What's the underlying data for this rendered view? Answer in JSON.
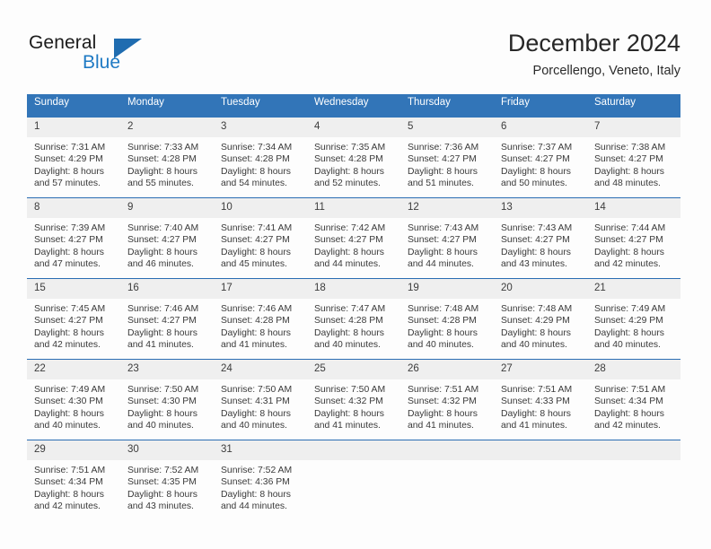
{
  "brand": {
    "name_top": "General",
    "name_bottom": "Blue",
    "triangle_color": "#1f6cb0",
    "blue_color": "#1f7ac4"
  },
  "header": {
    "title": "December 2024",
    "subtitle": "Porcellengo, Veneto, Italy"
  },
  "theme": {
    "header_bg": "#3275b8",
    "header_text": "#ffffff",
    "row_divider": "#2a6db3",
    "daynum_bg": "#efefef",
    "page_bg": "#fdfdfd"
  },
  "weekdays": [
    "Sunday",
    "Monday",
    "Tuesday",
    "Wednesday",
    "Thursday",
    "Friday",
    "Saturday"
  ],
  "weeks": [
    [
      {
        "day": "1",
        "sunrise": "Sunrise: 7:31 AM",
        "sunset": "Sunset: 4:29 PM",
        "daylight1": "Daylight: 8 hours",
        "daylight2": "and 57 minutes."
      },
      {
        "day": "2",
        "sunrise": "Sunrise: 7:33 AM",
        "sunset": "Sunset: 4:28 PM",
        "daylight1": "Daylight: 8 hours",
        "daylight2": "and 55 minutes."
      },
      {
        "day": "3",
        "sunrise": "Sunrise: 7:34 AM",
        "sunset": "Sunset: 4:28 PM",
        "daylight1": "Daylight: 8 hours",
        "daylight2": "and 54 minutes."
      },
      {
        "day": "4",
        "sunrise": "Sunrise: 7:35 AM",
        "sunset": "Sunset: 4:28 PM",
        "daylight1": "Daylight: 8 hours",
        "daylight2": "and 52 minutes."
      },
      {
        "day": "5",
        "sunrise": "Sunrise: 7:36 AM",
        "sunset": "Sunset: 4:27 PM",
        "daylight1": "Daylight: 8 hours",
        "daylight2": "and 51 minutes."
      },
      {
        "day": "6",
        "sunrise": "Sunrise: 7:37 AM",
        "sunset": "Sunset: 4:27 PM",
        "daylight1": "Daylight: 8 hours",
        "daylight2": "and 50 minutes."
      },
      {
        "day": "7",
        "sunrise": "Sunrise: 7:38 AM",
        "sunset": "Sunset: 4:27 PM",
        "daylight1": "Daylight: 8 hours",
        "daylight2": "and 48 minutes."
      }
    ],
    [
      {
        "day": "8",
        "sunrise": "Sunrise: 7:39 AM",
        "sunset": "Sunset: 4:27 PM",
        "daylight1": "Daylight: 8 hours",
        "daylight2": "and 47 minutes."
      },
      {
        "day": "9",
        "sunrise": "Sunrise: 7:40 AM",
        "sunset": "Sunset: 4:27 PM",
        "daylight1": "Daylight: 8 hours",
        "daylight2": "and 46 minutes."
      },
      {
        "day": "10",
        "sunrise": "Sunrise: 7:41 AM",
        "sunset": "Sunset: 4:27 PM",
        "daylight1": "Daylight: 8 hours",
        "daylight2": "and 45 minutes."
      },
      {
        "day": "11",
        "sunrise": "Sunrise: 7:42 AM",
        "sunset": "Sunset: 4:27 PM",
        "daylight1": "Daylight: 8 hours",
        "daylight2": "and 44 minutes."
      },
      {
        "day": "12",
        "sunrise": "Sunrise: 7:43 AM",
        "sunset": "Sunset: 4:27 PM",
        "daylight1": "Daylight: 8 hours",
        "daylight2": "and 44 minutes."
      },
      {
        "day": "13",
        "sunrise": "Sunrise: 7:43 AM",
        "sunset": "Sunset: 4:27 PM",
        "daylight1": "Daylight: 8 hours",
        "daylight2": "and 43 minutes."
      },
      {
        "day": "14",
        "sunrise": "Sunrise: 7:44 AM",
        "sunset": "Sunset: 4:27 PM",
        "daylight1": "Daylight: 8 hours",
        "daylight2": "and 42 minutes."
      }
    ],
    [
      {
        "day": "15",
        "sunrise": "Sunrise: 7:45 AM",
        "sunset": "Sunset: 4:27 PM",
        "daylight1": "Daylight: 8 hours",
        "daylight2": "and 42 minutes."
      },
      {
        "day": "16",
        "sunrise": "Sunrise: 7:46 AM",
        "sunset": "Sunset: 4:27 PM",
        "daylight1": "Daylight: 8 hours",
        "daylight2": "and 41 minutes."
      },
      {
        "day": "17",
        "sunrise": "Sunrise: 7:46 AM",
        "sunset": "Sunset: 4:28 PM",
        "daylight1": "Daylight: 8 hours",
        "daylight2": "and 41 minutes."
      },
      {
        "day": "18",
        "sunrise": "Sunrise: 7:47 AM",
        "sunset": "Sunset: 4:28 PM",
        "daylight1": "Daylight: 8 hours",
        "daylight2": "and 40 minutes."
      },
      {
        "day": "19",
        "sunrise": "Sunrise: 7:48 AM",
        "sunset": "Sunset: 4:28 PM",
        "daylight1": "Daylight: 8 hours",
        "daylight2": "and 40 minutes."
      },
      {
        "day": "20",
        "sunrise": "Sunrise: 7:48 AM",
        "sunset": "Sunset: 4:29 PM",
        "daylight1": "Daylight: 8 hours",
        "daylight2": "and 40 minutes."
      },
      {
        "day": "21",
        "sunrise": "Sunrise: 7:49 AM",
        "sunset": "Sunset: 4:29 PM",
        "daylight1": "Daylight: 8 hours",
        "daylight2": "and 40 minutes."
      }
    ],
    [
      {
        "day": "22",
        "sunrise": "Sunrise: 7:49 AM",
        "sunset": "Sunset: 4:30 PM",
        "daylight1": "Daylight: 8 hours",
        "daylight2": "and 40 minutes."
      },
      {
        "day": "23",
        "sunrise": "Sunrise: 7:50 AM",
        "sunset": "Sunset: 4:30 PM",
        "daylight1": "Daylight: 8 hours",
        "daylight2": "and 40 minutes."
      },
      {
        "day": "24",
        "sunrise": "Sunrise: 7:50 AM",
        "sunset": "Sunset: 4:31 PM",
        "daylight1": "Daylight: 8 hours",
        "daylight2": "and 40 minutes."
      },
      {
        "day": "25",
        "sunrise": "Sunrise: 7:50 AM",
        "sunset": "Sunset: 4:32 PM",
        "daylight1": "Daylight: 8 hours",
        "daylight2": "and 41 minutes."
      },
      {
        "day": "26",
        "sunrise": "Sunrise: 7:51 AM",
        "sunset": "Sunset: 4:32 PM",
        "daylight1": "Daylight: 8 hours",
        "daylight2": "and 41 minutes."
      },
      {
        "day": "27",
        "sunrise": "Sunrise: 7:51 AM",
        "sunset": "Sunset: 4:33 PM",
        "daylight1": "Daylight: 8 hours",
        "daylight2": "and 41 minutes."
      },
      {
        "day": "28",
        "sunrise": "Sunrise: 7:51 AM",
        "sunset": "Sunset: 4:34 PM",
        "daylight1": "Daylight: 8 hours",
        "daylight2": "and 42 minutes."
      }
    ],
    [
      {
        "day": "29",
        "sunrise": "Sunrise: 7:51 AM",
        "sunset": "Sunset: 4:34 PM",
        "daylight1": "Daylight: 8 hours",
        "daylight2": "and 42 minutes."
      },
      {
        "day": "30",
        "sunrise": "Sunrise: 7:52 AM",
        "sunset": "Sunset: 4:35 PM",
        "daylight1": "Daylight: 8 hours",
        "daylight2": "and 43 minutes."
      },
      {
        "day": "31",
        "sunrise": "Sunrise: 7:52 AM",
        "sunset": "Sunset: 4:36 PM",
        "daylight1": "Daylight: 8 hours",
        "daylight2": "and 44 minutes."
      },
      {
        "day": "",
        "sunrise": "",
        "sunset": "",
        "daylight1": "",
        "daylight2": ""
      },
      {
        "day": "",
        "sunrise": "",
        "sunset": "",
        "daylight1": "",
        "daylight2": ""
      },
      {
        "day": "",
        "sunrise": "",
        "sunset": "",
        "daylight1": "",
        "daylight2": ""
      },
      {
        "day": "",
        "sunrise": "",
        "sunset": "",
        "daylight1": "",
        "daylight2": ""
      }
    ]
  ]
}
